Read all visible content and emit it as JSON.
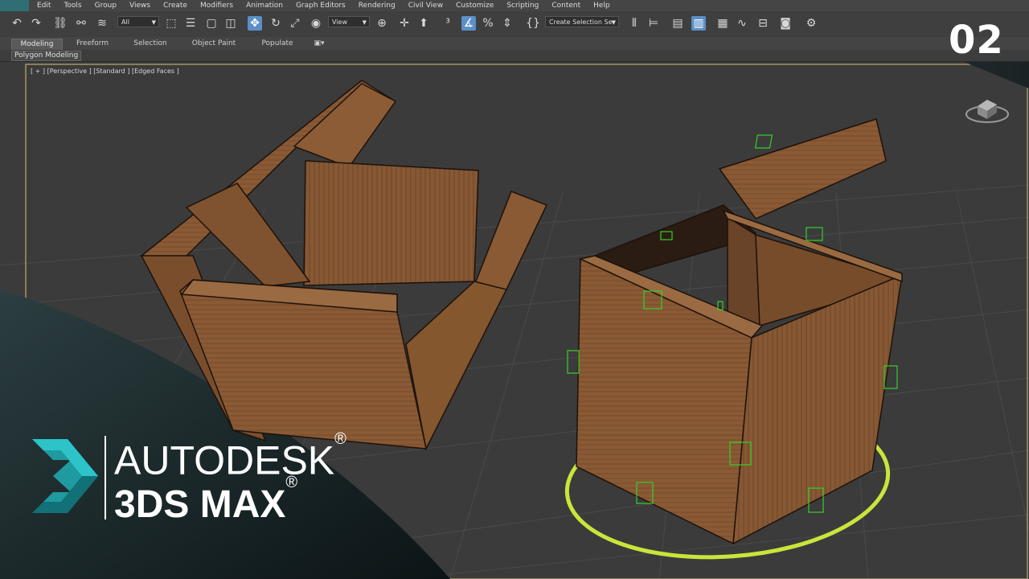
{
  "menu": [
    "Edit",
    "Tools",
    "Group",
    "Views",
    "Create",
    "Modifiers",
    "Animation",
    "Graph Editors",
    "Rendering",
    "Civil View",
    "Customize",
    "Scripting",
    "Content",
    "Help"
  ],
  "toolbar": {
    "filter_value": "All",
    "refcoord_value": "View",
    "named_selection_value": "Create Selection Se"
  },
  "ribbon": {
    "tabs": [
      "Modeling",
      "Freeform",
      "Selection",
      "Object Paint",
      "Populate"
    ],
    "selected": "Modeling",
    "panel": "Polygon Modeling"
  },
  "viewport": {
    "label": "[ + ] [Perspective ] [Standard ] [Edged Faces ]"
  },
  "episode": "02",
  "brand": {
    "line1": "AUTODESK",
    "line2": "3DS MAX",
    "reg": "®"
  },
  "colors": {
    "viewport_bg": "#3b3b3b",
    "grid": "#4a4a4a",
    "cardboard": "#8a5a35",
    "gizmo_ring": "#c8e63a",
    "selection_handles": "#34d02a",
    "logo_teal": "#1f9aa0"
  }
}
